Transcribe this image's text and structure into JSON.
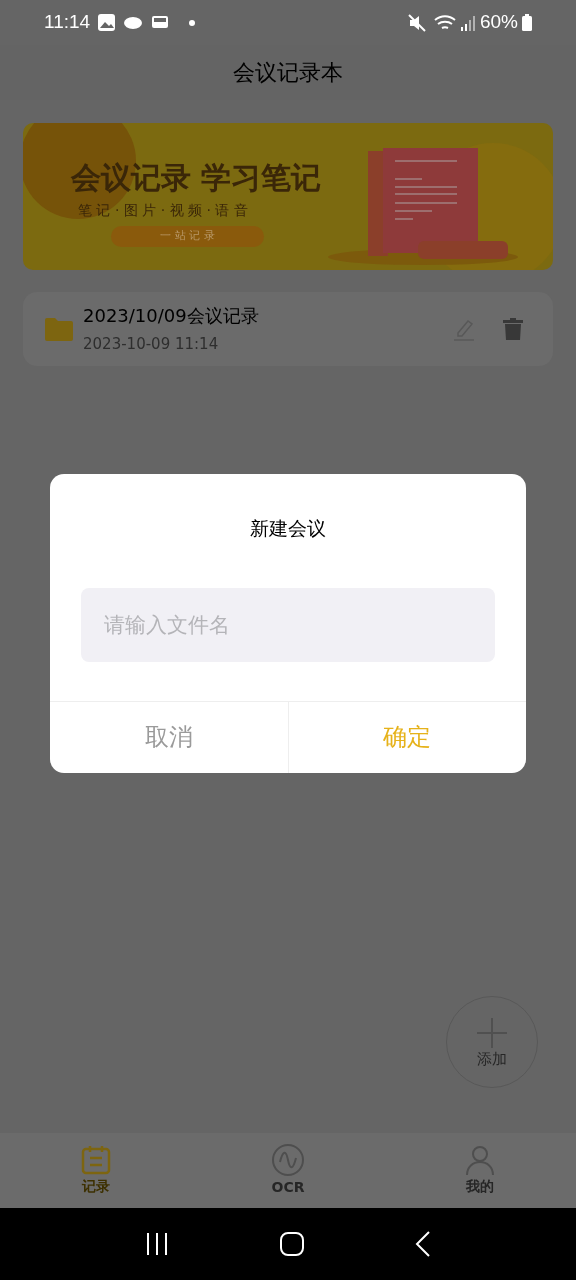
{
  "status_bar": {
    "time": "11:14",
    "battery": "60%"
  },
  "header": {
    "title": "会议记录本"
  },
  "banner": {
    "headline": "会议记录 学习笔记",
    "subline": "笔 记 · 图 片 · 视 频 · 语 音",
    "pill": "一 站 记 录"
  },
  "records": [
    {
      "title": "2023/10/09会议记录",
      "time": "2023-10-09 11:14"
    }
  ],
  "fab": {
    "label": "添加"
  },
  "tabs": [
    {
      "label": "记录",
      "kind": "calendar",
      "selected": true
    },
    {
      "label": "OCR",
      "kind": "wave",
      "selected": false
    },
    {
      "label": "我的",
      "kind": "person",
      "selected": false
    }
  ],
  "dialog": {
    "title": "新建会议",
    "placeholder": "请输入文件名",
    "buttons": [
      {
        "label": "取消",
        "kind": "cancel"
      },
      {
        "label": "确定",
        "kind": "confirm"
      }
    ]
  }
}
